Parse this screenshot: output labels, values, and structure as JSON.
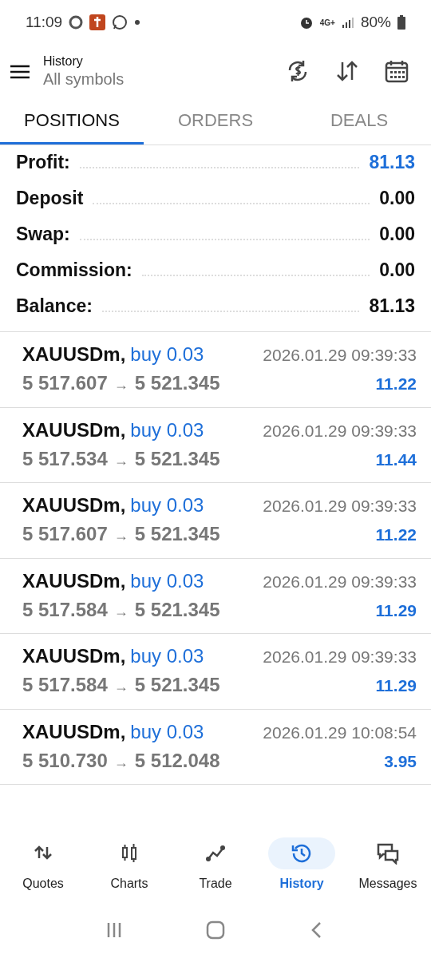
{
  "status_bar": {
    "time": "11:09",
    "network": "4G+",
    "battery": "80%"
  },
  "header": {
    "title": "History",
    "subtitle": "All symbols"
  },
  "tabs": [
    {
      "label": "POSITIONS",
      "selected": true
    },
    {
      "label": "ORDERS",
      "selected": false
    },
    {
      "label": "DEALS",
      "selected": false
    }
  ],
  "summary": [
    {
      "label": "Profit:",
      "value": "81.13",
      "accent": true
    },
    {
      "label": "Deposit",
      "value": "0.00",
      "accent": false
    },
    {
      "label": "Swap:",
      "value": "0.00",
      "accent": false
    },
    {
      "label": "Commission:",
      "value": "0.00",
      "accent": false
    },
    {
      "label": "Balance:",
      "value": "81.13",
      "accent": false
    }
  ],
  "trades": [
    {
      "symbol": "XAUUSDm,",
      "side": "buy 0.03",
      "time": "2026.01.29 09:39:33",
      "open": "5 517.607",
      "arrow": "→",
      "close": "5 521.345",
      "profit": "11.22"
    },
    {
      "symbol": "XAUUSDm,",
      "side": "buy 0.03",
      "time": "2026.01.29 09:39:33",
      "open": "5 517.534",
      "arrow": "→",
      "close": "5 521.345",
      "profit": "11.44"
    },
    {
      "symbol": "XAUUSDm,",
      "side": "buy 0.03",
      "time": "2026.01.29 09:39:33",
      "open": "5 517.607",
      "arrow": "→",
      "close": "5 521.345",
      "profit": "11.22"
    },
    {
      "symbol": "XAUUSDm,",
      "side": "buy 0.03",
      "time": "2026.01.29 09:39:33",
      "open": "5 517.584",
      "arrow": "→",
      "close": "5 521.345",
      "profit": "11.29"
    },
    {
      "symbol": "XAUUSDm,",
      "side": "buy 0.03",
      "time": "2026.01.29 09:39:33",
      "open": "5 517.584",
      "arrow": "→",
      "close": "5 521.345",
      "profit": "11.29"
    },
    {
      "symbol": "XAUUSDm,",
      "side": "buy 0.03",
      "time": "2026.01.29 10:08:54",
      "open": "5 510.730",
      "arrow": "→",
      "close": "5 512.048",
      "profit": "3.95"
    }
  ],
  "bottom_nav": [
    {
      "label": "Quotes",
      "selected": false
    },
    {
      "label": "Charts",
      "selected": false
    },
    {
      "label": "Trade",
      "selected": false
    },
    {
      "label": "History",
      "selected": true
    },
    {
      "label": "Messages",
      "selected": false
    }
  ]
}
